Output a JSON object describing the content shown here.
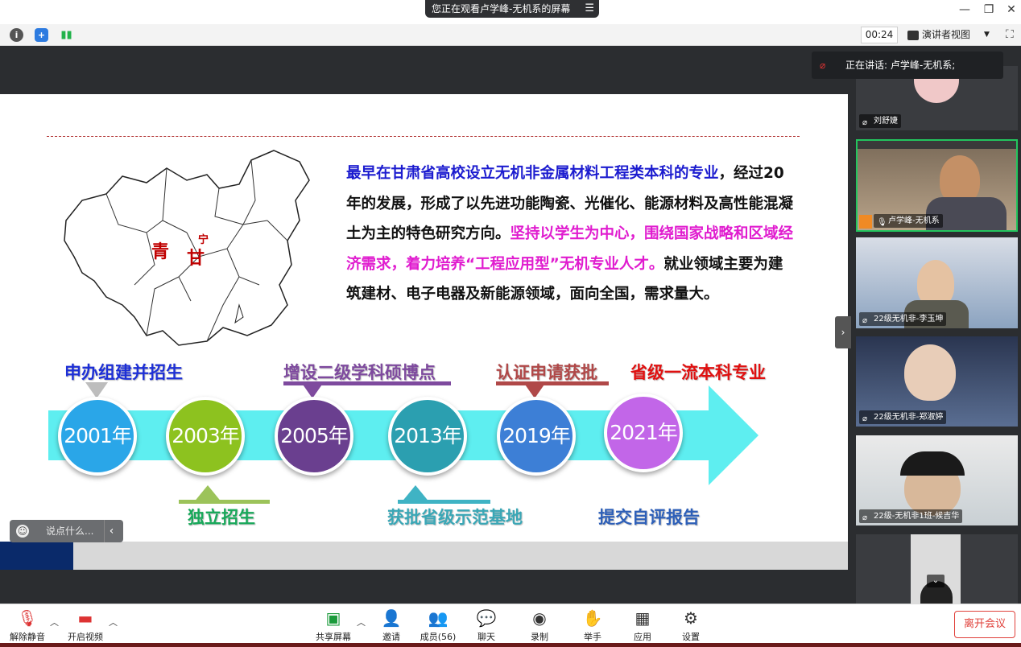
{
  "window": {
    "share_banner": "您正在观看卢学峰-无机系的屏幕",
    "share_menu_icon": "hamburger-icon",
    "timer": "00:24",
    "view_mode": "演讲者视图"
  },
  "speaking": {
    "label": "正在讲话: 卢学峰-无机系;"
  },
  "slide": {
    "map_labels": {
      "qing": "青",
      "gan": "甘",
      "ning": "宁"
    },
    "para_blue": "最早在甘肃省高校设立无机非金属材料工程类本科的专业",
    "para_black1": "，经过20年的发展，形成了以先进功能陶瓷、光催化、能源材料及高性能混凝土为主的特色研究方向。",
    "para_magenta": "坚持以学生为中心，围绕国家战略和区域经济需求，着力培养“工程应用型”无机专业人才。",
    "para_black2": "就业领域主要为建筑建材、电子电器及新能源领域，面向全国，需求量大。",
    "years": [
      "2001年",
      "2003年",
      "2005年",
      "2013年",
      "2019年",
      "2021年"
    ],
    "year_colors": [
      "#2aa6e8",
      "#8dc21f",
      "#6a3f8f",
      "#2b9fb0",
      "#3d7fd6",
      "#c266e8"
    ],
    "milestones_top": [
      "申办组建并招生",
      "增设二级学科硕博点",
      "认证申请获批",
      "省级一流本科专业"
    ],
    "milestones_bottom": [
      "独立招生",
      "获批省级示范基地",
      "提交自评报告"
    ]
  },
  "chat_input": {
    "placeholder": "说点什么..."
  },
  "participants": [
    {
      "name": "刘舒婕"
    },
    {
      "name": "卢学峰-无机系"
    },
    {
      "name": "22级无机非-李玉坤"
    },
    {
      "name": "22级无机非-郑淑婷"
    },
    {
      "name": "22级-无机非1班-候吉华"
    }
  ],
  "controls": {
    "mute": "解除静音",
    "video": "开启视频",
    "share": "共享屏幕",
    "invite": "邀请",
    "members": "成员(56)",
    "chat": "聊天",
    "record": "录制",
    "raise_hand": "举手",
    "apps": "应用",
    "settings": "设置",
    "leave": "离开会议"
  }
}
